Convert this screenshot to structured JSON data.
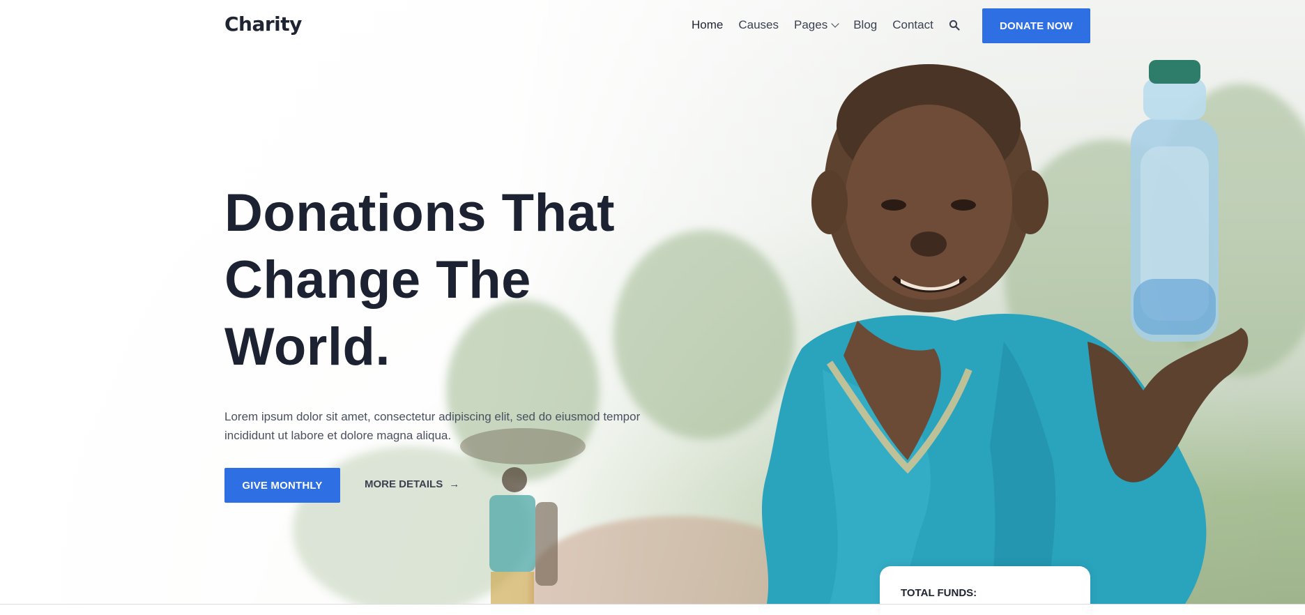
{
  "brand": {
    "logo": "Charity",
    "accent": "#2f6fe4"
  },
  "nav": {
    "items": [
      {
        "label": "Home",
        "active": true
      },
      {
        "label": "Causes"
      },
      {
        "label": "Pages",
        "dropdown": true
      },
      {
        "label": "Blog"
      },
      {
        "label": "Contact"
      }
    ],
    "search_icon": "search-icon",
    "cta_label": "DONATE NOW"
  },
  "hero": {
    "headline": [
      "Donations That",
      "Change The",
      "World."
    ],
    "lead": "Lorem ipsum dolor sit amet, consectetur adipiscing elit, sed do eiusmod tempor incididunt ut labore et dolore magna aliqua.",
    "primary_cta": "GIVE MONTHLY",
    "secondary_cta": "MORE DETAILS",
    "secondary_icon": "arrow-right-icon"
  },
  "funds_card": {
    "label": "TOTAL FUNDS:"
  }
}
